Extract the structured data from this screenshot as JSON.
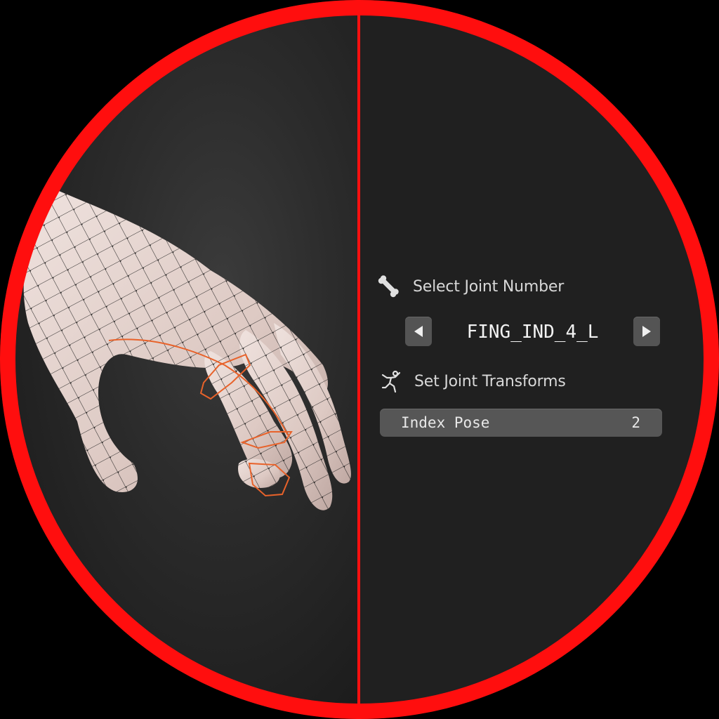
{
  "panel": {
    "joint_section": {
      "icon": "bone-icon",
      "title": "Select Joint Number",
      "prev_icon": "triangle-left-icon",
      "next_icon": "triangle-right-icon",
      "current_joint": "FING_IND_4_L"
    },
    "transform_section": {
      "icon": "pose-figure-icon",
      "title": "Set Joint Transforms",
      "field_label": "Index Pose",
      "field_value": "2"
    }
  },
  "colors": {
    "ring": "#ff0e0e",
    "panel_bg": "#202020",
    "button_bg": "#545454",
    "field_bg": "#565656",
    "bone_highlight": "#e8622a",
    "mesh_skin": "#e2d1cc"
  }
}
